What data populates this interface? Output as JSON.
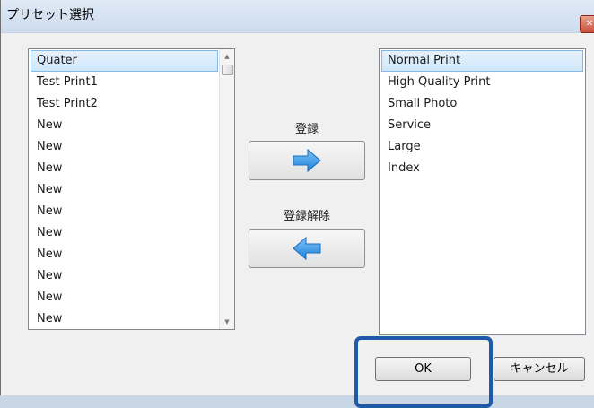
{
  "window": {
    "title": "プリセット選択",
    "close_icon": "close-icon"
  },
  "left_list": {
    "items": [
      {
        "label": "Quater",
        "selected": true
      },
      {
        "label": "Test Print1"
      },
      {
        "label": "Test Print2"
      },
      {
        "label": "New"
      },
      {
        "label": "New"
      },
      {
        "label": "New"
      },
      {
        "label": "New"
      },
      {
        "label": "New"
      },
      {
        "label": "New"
      },
      {
        "label": "New"
      },
      {
        "label": "New"
      },
      {
        "label": "New"
      },
      {
        "label": "New"
      }
    ]
  },
  "right_list": {
    "items": [
      {
        "label": "Normal Print",
        "selected": true
      },
      {
        "label": "High Quality Print"
      },
      {
        "label": "Small Photo"
      },
      {
        "label": "Service"
      },
      {
        "label": "Large"
      },
      {
        "label": "Index"
      }
    ]
  },
  "actions": {
    "register_label": "登録",
    "register_icon": "arrow-right-icon",
    "unregister_label": "登録解除",
    "unregister_icon": "arrow-left-icon",
    "arrow_color": "#2f8fe0"
  },
  "footer": {
    "ok_label": "OK",
    "cancel_label": "キャンセル",
    "highlight_color": "#1e5aa8"
  }
}
